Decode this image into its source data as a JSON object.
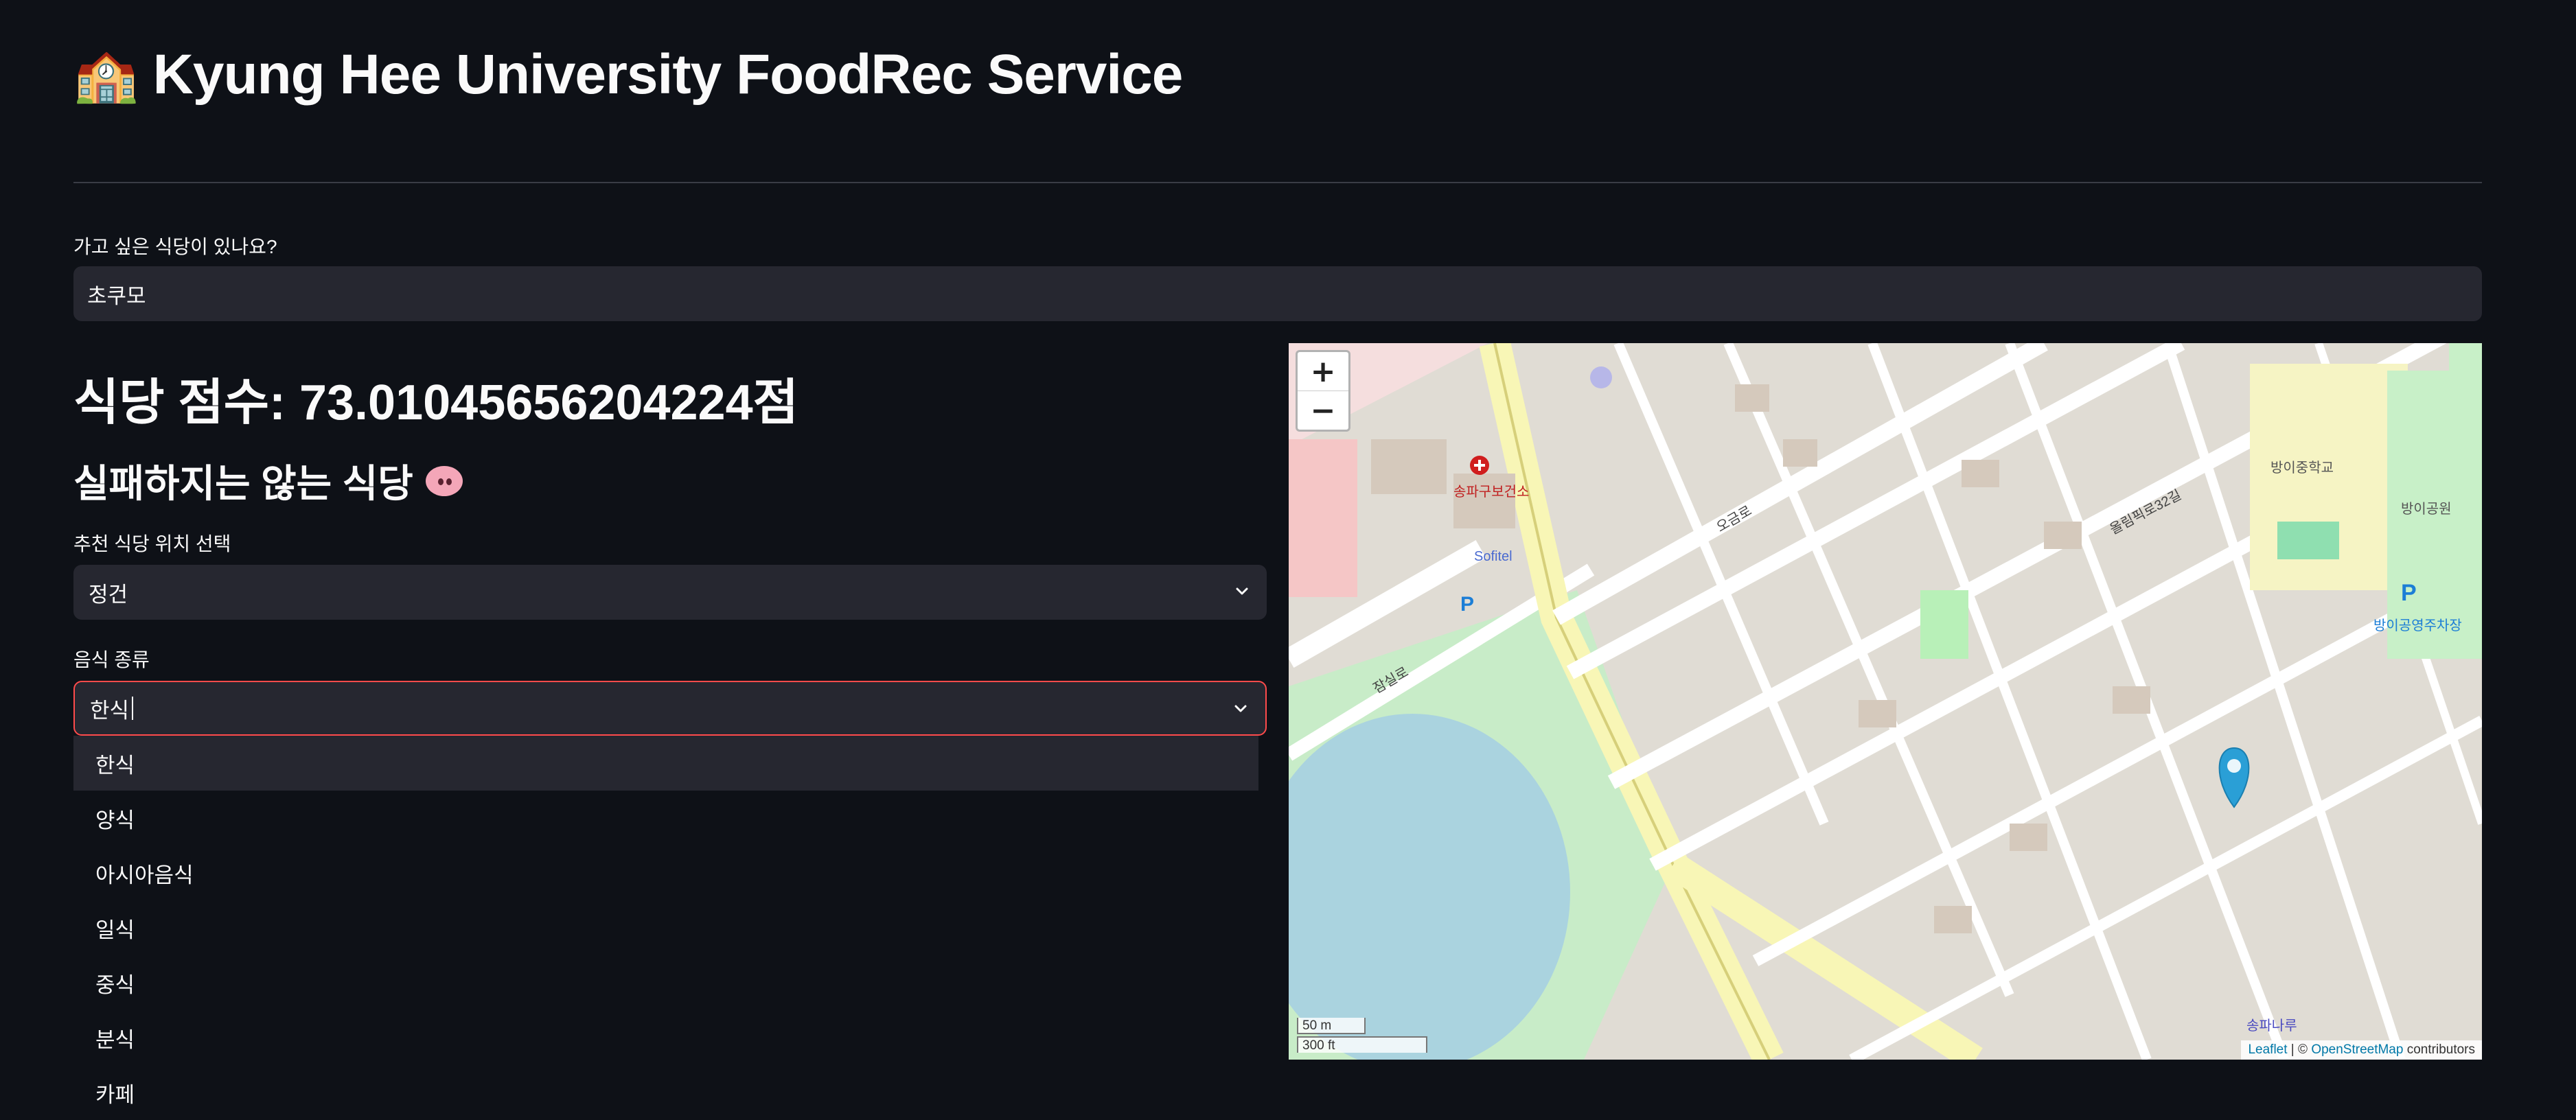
{
  "header": {
    "emoji": "🏫",
    "title": "Kyung Hee University FoodRec Service"
  },
  "search": {
    "label": "가고 싶은 식당이 있나요?",
    "value": "초쿠모"
  },
  "score": {
    "text": "식당 점수: 73.01045656204224점"
  },
  "result": {
    "heading": "실패하지는 않는 식당"
  },
  "location_select": {
    "label": "추천 식당 위치 선택",
    "value": "정건"
  },
  "food_select": {
    "label": "음식 종류",
    "value": "한식",
    "options": [
      "한식",
      "양식",
      "아시아음식",
      "일식",
      "중식",
      "분식",
      "카페"
    ],
    "highlighted_index": 0
  },
  "map": {
    "zoom_in": "+",
    "zoom_out": "−",
    "scale_m": "50 m",
    "scale_ft": "300 ft",
    "attribution_leaflet": "Leaflet",
    "attribution_sep": " | © ",
    "attribution_osm": "OpenStreetMap",
    "attribution_suffix": " contributors",
    "marker_color": "#2a9fd6",
    "labels": {
      "sofitel": "Sofitel",
      "banglake": "방이중학교",
      "park": "방이공원",
      "jamsilro": "잠실로",
      "ogeumro": "오금로",
      "olympic32": "올림픽로32길",
      "songpa": "송파나루",
      "clinic": "송파구보건소",
      "parking": "방이공영주차장"
    }
  },
  "colors": {
    "background": "#0e1117",
    "input_bg": "#262730",
    "accent_border": "#ff4b4b"
  }
}
